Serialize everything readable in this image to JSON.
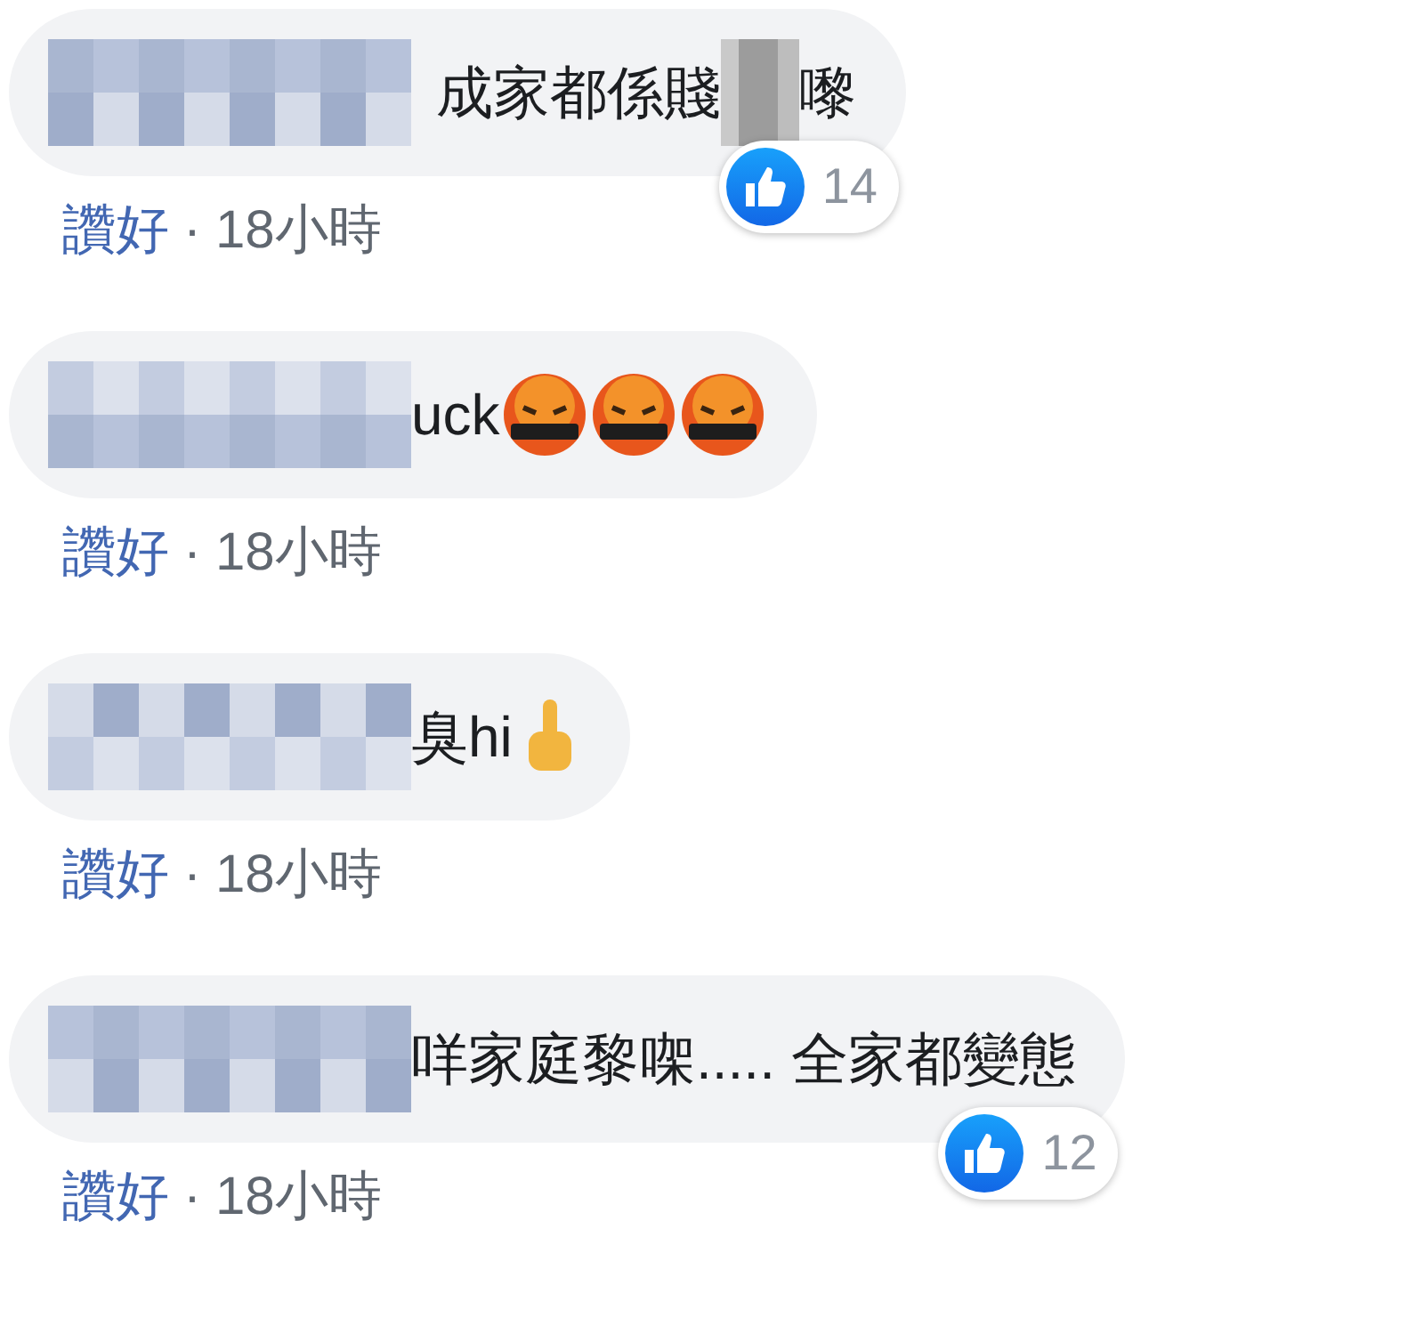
{
  "comments": [
    {
      "segments": [
        {
          "kind": "name_blur"
        },
        {
          "kind": "text",
          "text": "成家都係賤"
        },
        {
          "kind": "redaction"
        },
        {
          "kind": "text",
          "text": "嚟"
        }
      ],
      "likes": "14",
      "like_action": "讚好",
      "separator": "·",
      "time": "18小時"
    },
    {
      "segments": [
        {
          "kind": "name_blur"
        },
        {
          "kind": "text",
          "text": "uck"
        },
        {
          "kind": "cursing_emoji"
        },
        {
          "kind": "cursing_emoji"
        },
        {
          "kind": "cursing_emoji"
        }
      ],
      "like_action": "讚好",
      "separator": "·",
      "time": "18小時"
    },
    {
      "segments": [
        {
          "kind": "name_blur"
        },
        {
          "kind": "text",
          "text": "臭hi"
        },
        {
          "kind": "finger_emoji"
        }
      ],
      "like_action": "讚好",
      "separator": "·",
      "time": "18小時"
    },
    {
      "segments": [
        {
          "kind": "name_blur"
        },
        {
          "kind": "text",
          "text": "咩家庭黎㗎..... 全家都變態"
        }
      ],
      "likes": "12",
      "like_action": "讚好",
      "separator": "·",
      "time": "18小時"
    }
  ]
}
